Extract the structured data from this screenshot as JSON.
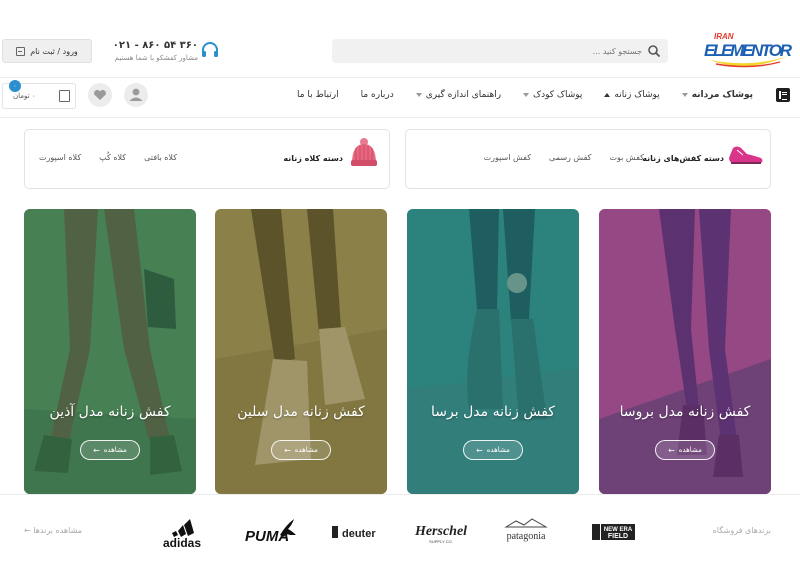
{
  "header": {
    "logo_small": "IRAN",
    "logo_main": "ELEMENTOR",
    "search_placeholder": "جستجو کنید ...",
    "phone": "۰۲۱ - ۸۶۰ ۵۴ ۳۶۰",
    "support_text": "مشاور کفشکو با شما هستیم",
    "login_label": "ورود / ثبت نام"
  },
  "nav": {
    "items": [
      {
        "label": "پوشاک مردانه",
        "caret": "down"
      },
      {
        "label": "پوشاک زنانه",
        "caret": "up"
      },
      {
        "label": "پوشاک کودک",
        "caret": "down"
      },
      {
        "label": "راهنمای اندازه گیری",
        "caret": "down"
      },
      {
        "label": "درباره ما",
        "caret": ""
      },
      {
        "label": "ارتباط با ما",
        "caret": ""
      }
    ],
    "cart_amount": "۰ تومان",
    "cart_count": "۰"
  },
  "categories": [
    {
      "title": "دسته کفش‌های زنانه",
      "links": [
        "کفش بوت",
        "کفش رسمی",
        "کفش اسپورت"
      ]
    },
    {
      "title": "دسته کلاه زنانه",
      "links": [
        "کلاه بافتی",
        "کلاه کُپ",
        "کلاه اسپورت"
      ]
    }
  ],
  "products": [
    {
      "title": "کفش زنانه مدل بروسا",
      "button": "مشاهده"
    },
    {
      "title": "کفش زنانه مدل برسا",
      "button": "مشاهده"
    },
    {
      "title": "کفش زنانه مدل سلین",
      "button": "مشاهده"
    },
    {
      "title": "کفش زنانه مدل آذین",
      "button": "مشاهده"
    }
  ],
  "brands": {
    "label": "برندهای فروشگاه",
    "more": "مشاهده برندها",
    "logos": [
      {
        "name": "NEW ERA FIELD",
        "line1": "NEW ERA",
        "line2": "FIELD"
      },
      {
        "name": "patagonia",
        "text": "patagonia"
      },
      {
        "name": "Herschel",
        "text": "Herschel",
        "sub": "SUPPLY CO."
      },
      {
        "name": "deuter",
        "text": "deuter"
      },
      {
        "name": "PUMA",
        "text": "PUMA"
      },
      {
        "name": "adidas",
        "text": "adidas"
      }
    ]
  },
  "colors": {
    "accent": "#2b8ecf",
    "logo_blue": "#1d5fb3",
    "logo_red": "#e33a2c",
    "logo_yellow": "#f3d52a",
    "overlay_purple": "#7a3c8c",
    "overlay_teal": "#207e78",
    "overlay_olive": "#7a6c2a",
    "overlay_green": "#2f7a4a"
  }
}
